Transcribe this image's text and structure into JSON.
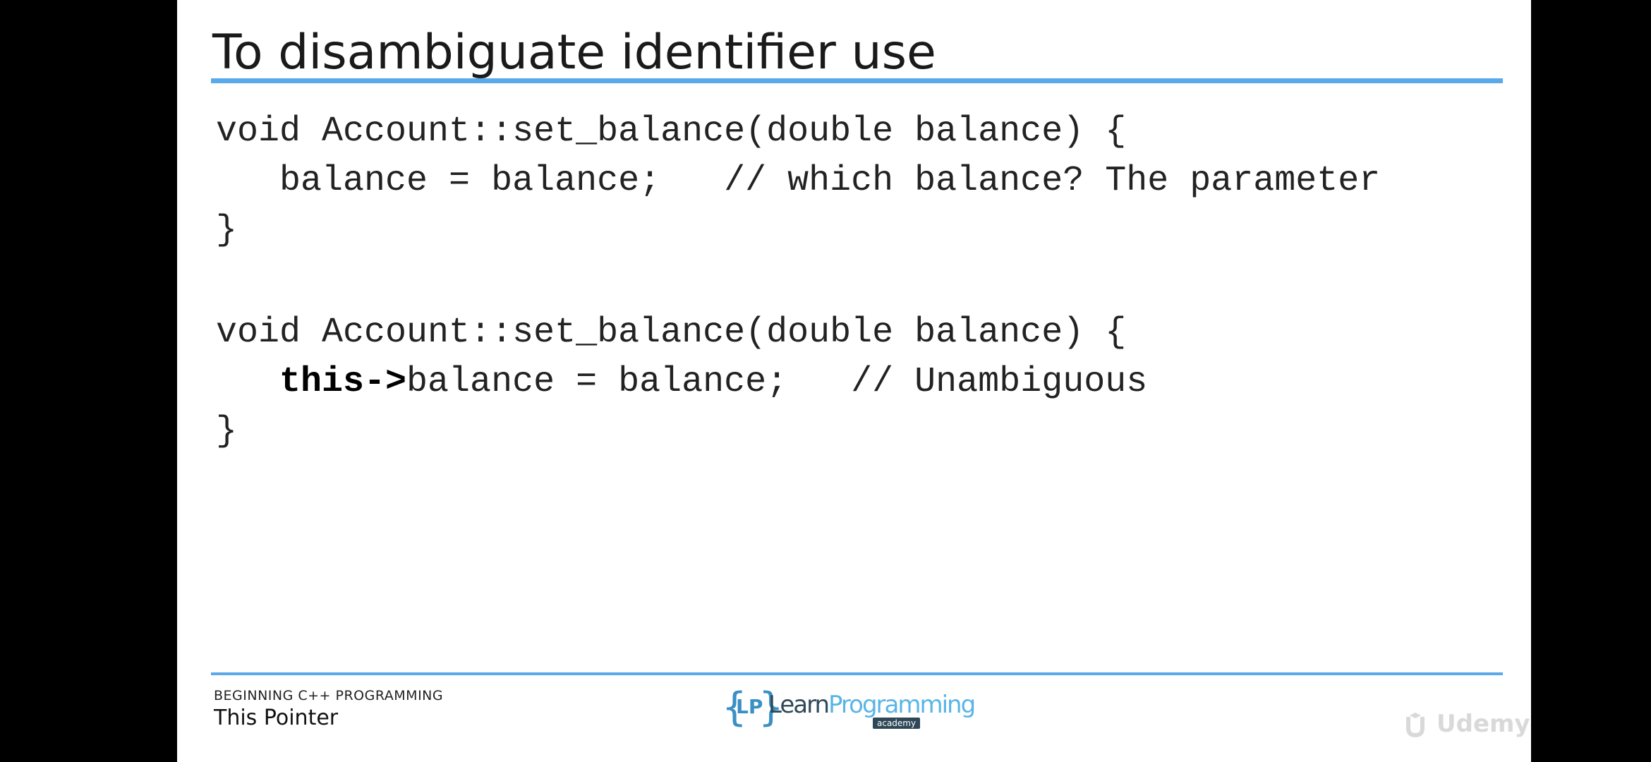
{
  "slide": {
    "title": "To disambiguate identifier use",
    "code_block_1": {
      "line1": "void Account::set_balance(double balance) {",
      "line2": "   balance = balance;   // which balance? The parameter",
      "line3": "}"
    },
    "code_block_2": {
      "line1": "void Account::set_balance(double balance) {",
      "line2_indent": "   ",
      "line2_keyword": "this->",
      "line2_rest": "balance = balance;   // Unambiguous",
      "line3": "}"
    },
    "footer": {
      "course": "BEGINNING C++ PROGRAMMING",
      "topic": "This Pointer"
    },
    "logo": {
      "brace_left": "{",
      "letters": "LP",
      "brace_right": "}",
      "learn": "Learn",
      "programming": "Programming",
      "academy": "academy"
    },
    "watermark": {
      "icon": "udemy-logo-icon",
      "text": "Udemy"
    }
  },
  "colors": {
    "accent_rule": "#5aa9ea",
    "background": "#000000",
    "slide": "#ffffff"
  }
}
